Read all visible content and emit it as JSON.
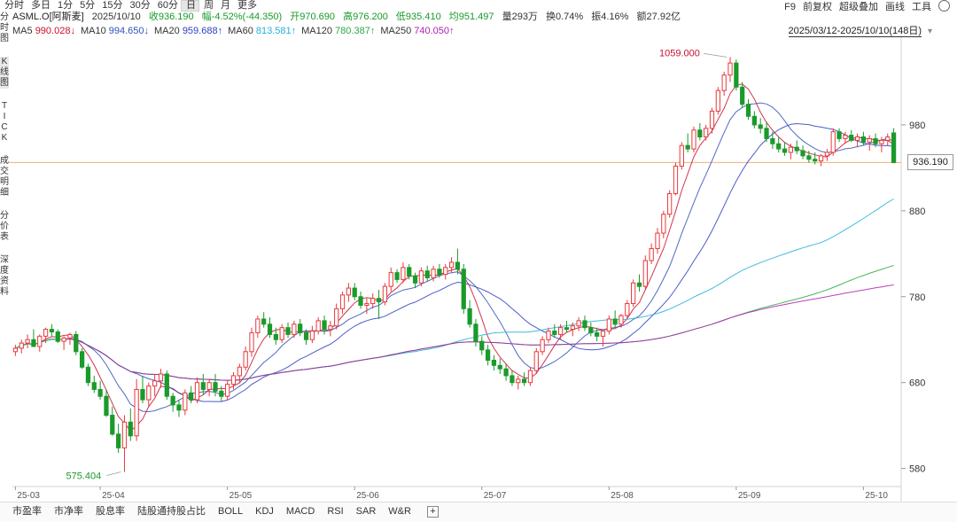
{
  "tabs": [
    "分时",
    "多日",
    "1分",
    "5分",
    "15分",
    "30分",
    "60分",
    "日",
    "周",
    "月",
    "更多"
  ],
  "active_tab": "日",
  "tools": [
    "F9",
    "前复权",
    "超级叠加",
    "画线",
    "工具"
  ],
  "side_tabs": [
    {
      "label": "分\n时\n图",
      "active": false
    },
    {
      "label": "K\n线\n图",
      "active": true
    },
    {
      "label": "T\nI\nC\nK",
      "active": false
    },
    {
      "label": "成\n交\n明\n细",
      "active": false
    },
    {
      "label": "分\n价\n表",
      "active": false
    },
    {
      "label": "深\n度\n资\n料",
      "active": false
    }
  ],
  "quote": {
    "symbol": "ASML.O[阿斯麦]",
    "date": "2025/10/10",
    "close": "收936.190",
    "change": "幅-4.52%(-44.350)",
    "open": "开970.690",
    "high": "高976.200",
    "low": "低935.410",
    "avg": "均951.497",
    "volume": "量293万",
    "turnover": "换0.74%",
    "amplitude": "振4.16%",
    "amount": "额27.92亿"
  },
  "ma": [
    {
      "label": "MA5",
      "value": "990.028↓",
      "color": "#c8102e"
    },
    {
      "label": "MA10",
      "value": "994.650↓",
      "color": "#3050b8"
    },
    {
      "label": "MA20",
      "value": "959.688↑",
      "color": "#2d3fc0"
    },
    {
      "label": "MA60",
      "value": "813.581↑",
      "color": "#22b0d8"
    },
    {
      "label": "MA120",
      "value": "780.387↑",
      "color": "#2aa844"
    },
    {
      "label": "MA250",
      "value": "740.050↑",
      "color": "#b020b0"
    }
  ],
  "date_range": "2025/03/12-2025/10/10(148日)",
  "current_price_label": "936.190",
  "indicators": [
    "市盈率",
    "市净率",
    "股息率",
    "陆股通持股占比",
    "BOLL",
    "KDJ",
    "MACD",
    "RSI",
    "SAR",
    "W&R"
  ],
  "chart_data": {
    "type": "candlestick",
    "y_ticks": [
      580,
      680,
      780,
      880,
      980
    ],
    "y_range": [
      560,
      1080
    ],
    "x_ticks": [
      "25-03",
      "25-04",
      "25-05",
      "25-06",
      "25-07",
      "25-08",
      "25-09",
      "25-10"
    ],
    "x_tick_index": [
      0,
      14,
      35,
      56,
      77,
      98,
      119,
      140
    ],
    "high_label": "1059.000",
    "low_label": "575.404",
    "current_price": 936.19,
    "colors": {
      "up": "#e8393b",
      "down": "#1a9a2a"
    },
    "candles": [
      [
        716,
        724,
        711,
        720
      ],
      [
        720,
        730,
        714,
        726
      ],
      [
        726,
        736,
        720,
        730
      ],
      [
        730,
        742,
        724,
        722
      ],
      [
        722,
        736,
        716,
        734
      ],
      [
        734,
        744,
        726,
        742
      ],
      [
        742,
        748,
        734,
        739
      ],
      [
        739,
        742,
        726,
        728
      ],
      [
        728,
        734,
        718,
        732
      ],
      [
        732,
        738,
        724,
        736
      ],
      [
        736,
        740,
        712,
        716
      ],
      [
        716,
        720,
        696,
        698
      ],
      [
        698,
        702,
        676,
        680
      ],
      [
        680,
        688,
        668,
        672
      ],
      [
        672,
        682,
        660,
        664
      ],
      [
        664,
        672,
        640,
        642
      ],
      [
        642,
        652,
        618,
        620
      ],
      [
        620,
        632,
        598,
        604
      ],
      [
        604,
        642,
        576,
        634
      ],
      [
        634,
        650,
        612,
        618
      ],
      [
        618,
        684,
        612,
        672
      ],
      [
        672,
        688,
        656,
        660
      ],
      [
        660,
        680,
        652,
        676
      ],
      [
        676,
        690,
        664,
        682
      ],
      [
        682,
        696,
        674,
        690
      ],
      [
        690,
        694,
        660,
        664
      ],
      [
        664,
        668,
        646,
        654
      ],
      [
        654,
        660,
        640,
        648
      ],
      [
        648,
        672,
        642,
        668
      ],
      [
        668,
        676,
        656,
        660
      ],
      [
        660,
        686,
        656,
        680
      ],
      [
        680,
        690,
        666,
        672
      ],
      [
        672,
        684,
        664,
        680
      ],
      [
        680,
        690,
        664,
        670
      ],
      [
        670,
        676,
        658,
        664
      ],
      [
        664,
        682,
        660,
        678
      ],
      [
        678,
        692,
        672,
        688
      ],
      [
        688,
        702,
        680,
        698
      ],
      [
        698,
        722,
        694,
        716
      ],
      [
        716,
        744,
        710,
        738
      ],
      [
        738,
        758,
        732,
        754
      ],
      [
        754,
        762,
        744,
        748
      ],
      [
        748,
        756,
        732,
        736
      ],
      [
        736,
        744,
        724,
        730
      ],
      [
        730,
        748,
        726,
        744
      ],
      [
        744,
        750,
        732,
        736
      ],
      [
        736,
        752,
        732,
        748
      ],
      [
        748,
        754,
        734,
        738
      ],
      [
        738,
        742,
        724,
        730
      ],
      [
        730,
        746,
        726,
        740
      ],
      [
        740,
        756,
        736,
        752
      ],
      [
        752,
        758,
        736,
        742
      ],
      [
        742,
        752,
        734,
        746
      ],
      [
        746,
        772,
        742,
        766
      ],
      [
        766,
        786,
        760,
        782
      ],
      [
        782,
        796,
        774,
        790
      ],
      [
        790,
        796,
        776,
        780
      ],
      [
        780,
        786,
        766,
        770
      ],
      [
        770,
        778,
        760,
        772
      ],
      [
        772,
        784,
        766,
        778
      ],
      [
        778,
        788,
        754,
        774
      ],
      [
        774,
        796,
        770,
        792
      ],
      [
        792,
        814,
        786,
        808
      ],
      [
        808,
        812,
        796,
        800
      ],
      [
        800,
        820,
        796,
        814
      ],
      [
        814,
        818,
        800,
        804
      ],
      [
        804,
        808,
        790,
        796
      ],
      [
        796,
        814,
        792,
        810
      ],
      [
        810,
        816,
        798,
        802
      ],
      [
        802,
        816,
        798,
        812
      ],
      [
        812,
        818,
        802,
        806
      ],
      [
        806,
        818,
        800,
        814
      ],
      [
        814,
        826,
        808,
        820
      ],
      [
        820,
        836,
        806,
        812
      ],
      [
        812,
        818,
        760,
        766
      ],
      [
        766,
        776,
        744,
        748
      ],
      [
        748,
        754,
        722,
        728
      ],
      [
        728,
        734,
        712,
        718
      ],
      [
        718,
        724,
        700,
        706
      ],
      [
        706,
        712,
        694,
        700
      ],
      [
        700,
        708,
        690,
        696
      ],
      [
        696,
        702,
        682,
        688
      ],
      [
        688,
        694,
        676,
        680
      ],
      [
        680,
        688,
        672,
        684
      ],
      [
        684,
        692,
        676,
        680
      ],
      [
        680,
        698,
        676,
        694
      ],
      [
        694,
        720,
        690,
        716
      ],
      [
        716,
        734,
        712,
        730
      ],
      [
        730,
        744,
        726,
        740
      ],
      [
        740,
        748,
        732,
        736
      ],
      [
        736,
        748,
        730,
        744
      ],
      [
        744,
        752,
        738,
        742
      ],
      [
        742,
        750,
        734,
        746
      ],
      [
        746,
        756,
        740,
        752
      ],
      [
        752,
        758,
        740,
        744
      ],
      [
        744,
        750,
        734,
        738
      ],
      [
        738,
        744,
        728,
        734
      ],
      [
        734,
        742,
        722,
        740
      ],
      [
        740,
        758,
        736,
        754
      ],
      [
        754,
        764,
        744,
        748
      ],
      [
        748,
        760,
        744,
        758
      ],
      [
        758,
        776,
        754,
        772
      ],
      [
        772,
        800,
        768,
        796
      ],
      [
        796,
        806,
        786,
        792
      ],
      [
        792,
        828,
        788,
        822
      ],
      [
        822,
        842,
        818,
        836
      ],
      [
        836,
        860,
        830,
        854
      ],
      [
        854,
        880,
        848,
        876
      ],
      [
        876,
        904,
        872,
        900
      ],
      [
        900,
        936,
        898,
        932
      ],
      [
        932,
        960,
        928,
        956
      ],
      [
        956,
        970,
        948,
        952
      ],
      [
        952,
        978,
        948,
        974
      ],
      [
        974,
        982,
        962,
        966
      ],
      [
        966,
        980,
        962,
        976
      ],
      [
        976,
        1000,
        970,
        996
      ],
      [
        996,
        1024,
        992,
        1020
      ],
      [
        1020,
        1042,
        1014,
        1038
      ],
      [
        1038,
        1059,
        1030,
        1052
      ],
      [
        1052,
        1056,
        1020,
        1024
      ],
      [
        1024,
        1030,
        1000,
        1004
      ],
      [
        1004,
        1010,
        986,
        990
      ],
      [
        990,
        996,
        976,
        980
      ],
      [
        980,
        988,
        970,
        976
      ],
      [
        976,
        984,
        960,
        964
      ],
      [
        964,
        972,
        952,
        958
      ],
      [
        958,
        966,
        948,
        952
      ],
      [
        952,
        960,
        944,
        948
      ],
      [
        948,
        958,
        940,
        954
      ],
      [
        954,
        962,
        946,
        950
      ],
      [
        950,
        956,
        940,
        944
      ],
      [
        944,
        950,
        936,
        940
      ],
      [
        940,
        948,
        934,
        938
      ],
      [
        938,
        946,
        932,
        944
      ],
      [
        944,
        952,
        938,
        948
      ],
      [
        948,
        976,
        944,
        972
      ],
      [
        972,
        976,
        960,
        964
      ],
      [
        964,
        972,
        958,
        968
      ],
      [
        968,
        974,
        960,
        962
      ],
      [
        962,
        970,
        954,
        966
      ],
      [
        966,
        972,
        956,
        960
      ],
      [
        960,
        968,
        950,
        964
      ],
      [
        964,
        970,
        954,
        958
      ],
      [
        958,
        966,
        948,
        962
      ],
      [
        962,
        970,
        956,
        966
      ],
      [
        970.69,
        976.2,
        935.41,
        936.19
      ]
    ]
  }
}
